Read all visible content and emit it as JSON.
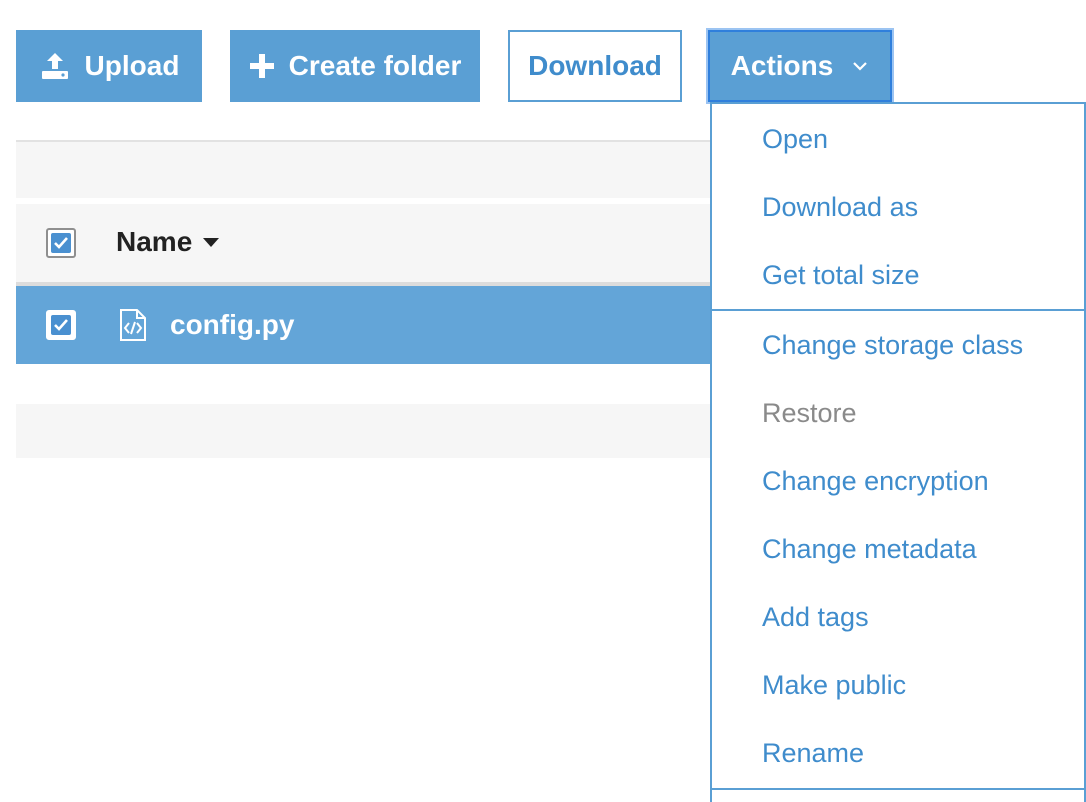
{
  "toolbar": {
    "upload_label": "Upload",
    "create_folder_label": "Create folder",
    "download_label": "Download",
    "actions_label": "Actions"
  },
  "table": {
    "name_header": "Name",
    "rows": [
      {
        "name": "config.py",
        "selected": true,
        "icon": "code-file-icon"
      }
    ]
  },
  "actions_menu": {
    "groups": [
      [
        {
          "label": "Open",
          "enabled": true
        },
        {
          "label": "Download as",
          "enabled": true
        },
        {
          "label": "Get total size",
          "enabled": true
        }
      ],
      [
        {
          "label": "Change storage class",
          "enabled": true
        },
        {
          "label": "Restore",
          "enabled": false
        },
        {
          "label": "Change encryption",
          "enabled": true
        },
        {
          "label": "Change metadata",
          "enabled": true
        },
        {
          "label": "Add tags",
          "enabled": true
        },
        {
          "label": "Make public",
          "enabled": true
        },
        {
          "label": "Rename",
          "enabled": true
        }
      ]
    ]
  },
  "colors": {
    "primary": "#5a9fd4",
    "link": "#3f8ccc",
    "selected_row": "#63a5d8",
    "disabled_text": "#8a8a8a",
    "focus_ring": "#2f7fdc"
  }
}
